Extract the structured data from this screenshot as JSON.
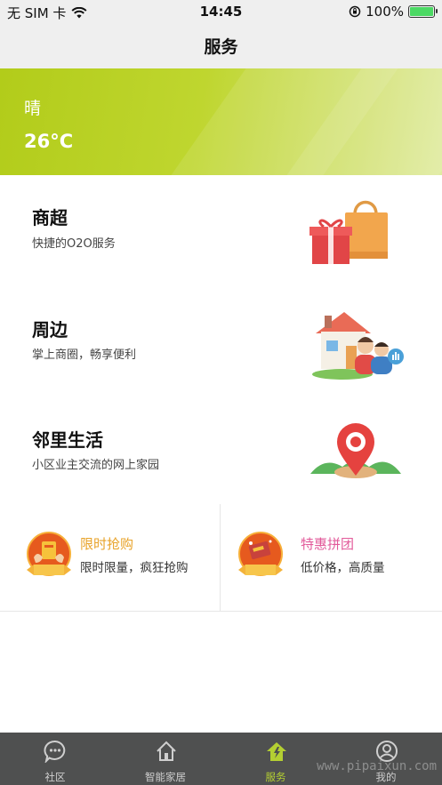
{
  "status_bar": {
    "carrier": "无 SIM 卡",
    "time": "14:45",
    "battery": "100%",
    "battery_level": 1.0
  },
  "nav": {
    "title": "服务"
  },
  "weather": {
    "condition": "晴",
    "temperature": "26°C"
  },
  "services": [
    {
      "title": "商超",
      "subtitle": "快捷的O2O服务",
      "icon": "shopping-bag-gift-icon"
    },
    {
      "title": "周边",
      "subtitle": "掌上商圈，畅享便利",
      "icon": "house-people-icon"
    },
    {
      "title": "邻里生活",
      "subtitle": "小区业主交流的网上家园",
      "icon": "map-pin-icon"
    }
  ],
  "promos": [
    {
      "title": "限时抢购",
      "subtitle": "限时限量，疯狂抢购",
      "title_color": "#e8a32a",
      "icon": "flash-sale-badge-icon"
    },
    {
      "title": "特惠拼团",
      "subtitle": "低价格，高质量",
      "title_color": "#e25a9a",
      "icon": "group-buy-badge-icon"
    }
  ],
  "tabs": [
    {
      "label": "社区",
      "icon": "chat-bubble-icon",
      "active": false
    },
    {
      "label": "智能家居",
      "icon": "home-icon",
      "active": false
    },
    {
      "label": "服务",
      "icon": "service-house-icon",
      "active": true
    },
    {
      "label": "我的",
      "icon": "user-icon",
      "active": false
    }
  ],
  "watermark": "www.pipaixun.com",
  "colors": {
    "accent": "#b4cf32",
    "tab_bar": "#4f5050",
    "weather_banner": "#bfd62f"
  }
}
